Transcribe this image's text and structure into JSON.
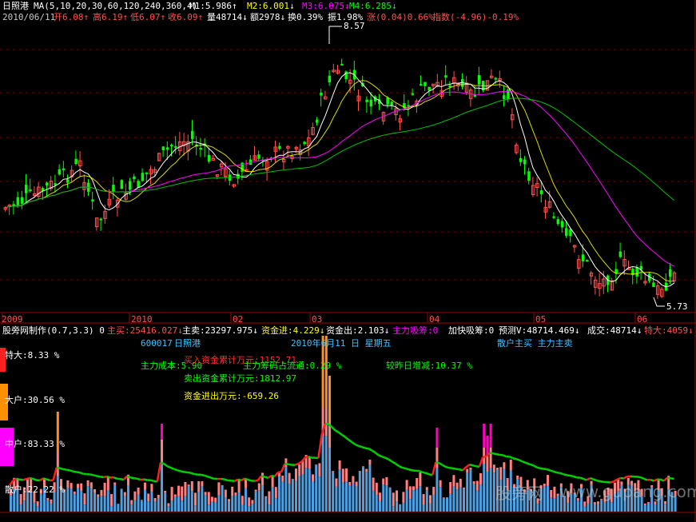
{
  "upper_panel": {
    "stock_name": "日照港",
    "ma_label": "MA(5,10,20,30,60,120,240,360,4)",
    "m1": "M1:5.986↑",
    "m2": "M2:6.001↓",
    "m3": "M3:6.075↓",
    "m4": "M4:6.285↓",
    "date": "2010/06/11",
    "open": "开6.08↑",
    "high": "高6.19↑",
    "low": "低6.07↑",
    "close": "收6.09↑",
    "volume": "量48714↓",
    "amount": "额2978↓",
    "turnover": "换0.39%",
    "amplitude": "振1.98%",
    "change": "涨(0.04)0.66%",
    "index": "指数(-4.96)-0.19%",
    "high_marker": "8.57",
    "low_marker": "5.73"
  },
  "time_axis": [
    "2009",
    "2010",
    "02",
    "03",
    "04",
    "05",
    "06"
  ],
  "lower_panel": {
    "indicator_name": "股旁网制作(0.7,3.3) 0",
    "main_buy": "主买:25416.027↓",
    "main_sell": "主卖:23297.975↓",
    "fund_in": "资金进:4.229↓",
    "fund_out": "资金出:2.103↓",
    "main_absorb": "主力吸筹:0",
    "accel_absorb": "加快吸筹:0",
    "forecast": "预测V:48714.469↓",
    "deal": "成交:48714↓",
    "super_large": "特大:4059↓",
    "code": "600017",
    "name": "日照港",
    "date_line": "2010年6月11 日 星期五",
    "retail_main": "散户主买 主力主卖",
    "main_cost": "主力成本:5.90",
    "buy_cum": "买入资金累计万元:1152.71",
    "chip_ratio": "主力筹码占流通:0.29 %",
    "yesterday_change": "较昨日增减:10.37 %",
    "sell_cum": "卖出资金累计万元:1812.97",
    "net_flow": "资金进出万元:-659.26",
    "legend_super": "特大:8.33 %",
    "legend_large": "大户:30.56 %",
    "legend_medium": "中户:83.33 %",
    "legend_retail": "散户:22.22 %"
  },
  "watermark": {
    "cn": "股旁网",
    "url": "www.gupang.com"
  },
  "colors": {
    "up": "#ff5050",
    "down": "#00ff00",
    "white_line": "#ffffff",
    "yellow_line": "#ffff00",
    "magenta_line": "#ff00ff",
    "green_line": "#00c000",
    "axis_red": "#a00000",
    "blue_bar": "#4fa0e0",
    "pink_bar": "#ff8080",
    "magenta_bar": "#ff00c0",
    "orange_bar": "#ff9020"
  }
}
